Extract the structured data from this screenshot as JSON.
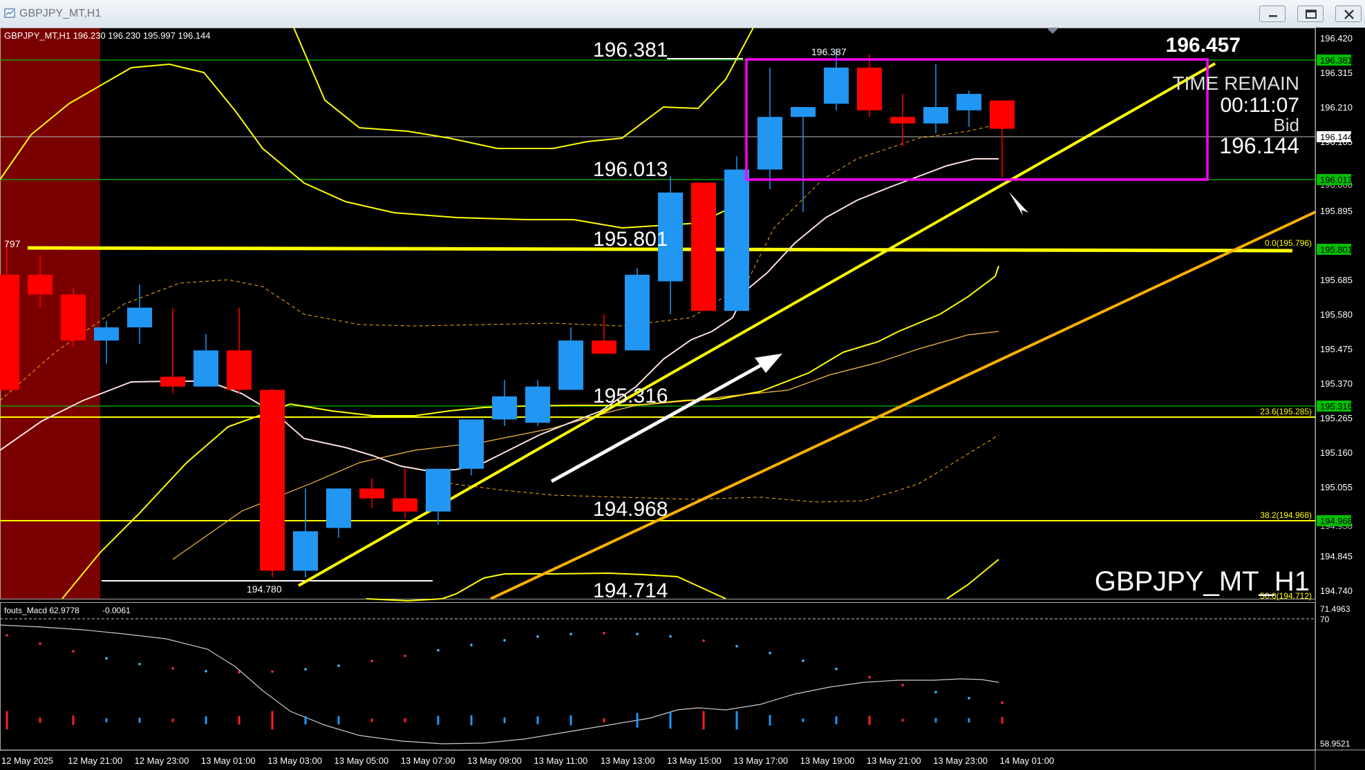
{
  "window": {
    "title": "GBPJPY_MT,H1",
    "icon": "chart-window-icon",
    "buttons": [
      "minimize-icon",
      "restore-icon",
      "close-icon"
    ]
  },
  "chart": {
    "info_line": "GBPJPY_MT,H1  196.230 196.230 195.997 196.144",
    "symbol_watermark": "GBPJPY_MT_H1",
    "colors": {
      "background": "#000000",
      "bull": "#2196f3",
      "bear": "#ff0000",
      "level": "#ffff00",
      "box": "#ff00ff",
      "price_tag_green": "#00c000"
    },
    "high_price_top": "196.457",
    "time_remain_label": "TIME REMAIN",
    "time_remain_value": "00:11:07",
    "bid_label": "Bid",
    "bid_value": "196.144",
    "level_labels": [
      "196.381",
      "196.013",
      "195.801",
      "195.316",
      "194.968",
      "194.714"
    ],
    "candle_high_label": "196.387",
    "candle_low_label": "194.780",
    "left_cut_label": "797",
    "fib_labels": [
      "0.0(195.796)",
      "23.6(195.285)",
      "38.2(194.968)",
      "50.0(194.712)"
    ],
    "price_axis": [
      "196.420",
      "196.315",
      "196.210",
      "196.105",
      "195.895",
      "195.685",
      "195.580",
      "195.475",
      "195.370",
      "195.265",
      "195.160",
      "195.055",
      "194.845",
      "194.740"
    ],
    "price_tags": {
      "green": [
        "196.381",
        "195.801",
        "195.316",
        "194.968"
      ],
      "bid": "196.144",
      "level": "196.013",
      "partial": "196.000",
      "partial2": "194.950"
    },
    "time_axis": [
      "12 May 2025",
      "12 May 21:00",
      "12 May 23:00",
      "13 May 01:00",
      "13 May 03:00",
      "13 May 05:00",
      "13 May 07:00",
      "13 May 09:00",
      "13 May 11:00",
      "13 May 13:00",
      "13 May 15:00",
      "13 May 17:00",
      "13 May 19:00",
      "13 May 21:00",
      "13 May 23:00",
      "14 May 01:00"
    ],
    "candles": [
      {
        "o": 195.7,
        "h": 195.8,
        "l": 195.35,
        "c": 195.35
      },
      {
        "o": 195.7,
        "h": 195.76,
        "l": 195.6,
        "c": 195.64
      },
      {
        "o": 195.64,
        "h": 195.66,
        "l": 195.48,
        "c": 195.5
      },
      {
        "o": 195.5,
        "h": 195.56,
        "l": 195.43,
        "c": 195.54
      },
      {
        "o": 195.54,
        "h": 195.67,
        "l": 195.49,
        "c": 195.6
      },
      {
        "o": 195.39,
        "h": 195.6,
        "l": 195.34,
        "c": 195.36
      },
      {
        "o": 195.36,
        "h": 195.52,
        "l": 195.36,
        "c": 195.47
      },
      {
        "o": 195.47,
        "h": 195.6,
        "l": 195.34,
        "c": 195.35
      },
      {
        "o": 195.35,
        "h": 195.35,
        "l": 194.78,
        "c": 194.8
      },
      {
        "o": 194.8,
        "h": 195.05,
        "l": 194.78,
        "c": 194.92
      },
      {
        "o": 194.93,
        "h": 195.05,
        "l": 194.9,
        "c": 195.05
      },
      {
        "o": 195.05,
        "h": 195.08,
        "l": 194.99,
        "c": 195.02
      },
      {
        "o": 195.02,
        "h": 195.11,
        "l": 194.96,
        "c": 194.98
      },
      {
        "o": 194.98,
        "h": 195.11,
        "l": 194.94,
        "c": 195.11
      },
      {
        "o": 195.11,
        "h": 195.25,
        "l": 195.09,
        "c": 195.26
      },
      {
        "o": 195.26,
        "h": 195.38,
        "l": 195.24,
        "c": 195.33
      },
      {
        "o": 195.25,
        "h": 195.38,
        "l": 195.24,
        "c": 195.36
      },
      {
        "o": 195.35,
        "h": 195.54,
        "l": 195.35,
        "c": 195.5
      },
      {
        "o": 195.5,
        "h": 195.58,
        "l": 195.46,
        "c": 195.46
      },
      {
        "o": 195.47,
        "h": 195.72,
        "l": 195.47,
        "c": 195.7
      },
      {
        "o": 195.68,
        "h": 196.0,
        "l": 195.58,
        "c": 195.95
      },
      {
        "o": 195.98,
        "h": 195.98,
        "l": 195.62,
        "c": 195.59
      },
      {
        "o": 195.59,
        "h": 196.06,
        "l": 195.59,
        "c": 196.02
      },
      {
        "o": 196.02,
        "h": 196.33,
        "l": 195.96,
        "c": 196.18
      },
      {
        "o": 196.18,
        "h": 196.21,
        "l": 195.89,
        "c": 196.21
      },
      {
        "o": 196.22,
        "h": 196.387,
        "l": 196.2,
        "c": 196.33
      },
      {
        "o": 196.33,
        "h": 196.37,
        "l": 196.18,
        "c": 196.2
      },
      {
        "o": 196.18,
        "h": 196.25,
        "l": 196.09,
        "c": 196.16
      },
      {
        "o": 196.16,
        "h": 196.34,
        "l": 196.13,
        "c": 196.21
      },
      {
        "o": 196.2,
        "h": 196.26,
        "l": 196.15,
        "c": 196.25
      },
      {
        "o": 196.23,
        "h": 196.23,
        "l": 195.997,
        "c": 196.144
      }
    ],
    "indicator": {
      "label": "fouts_Macd 62.9778",
      "label2": "-0.0061",
      "axis_top": "71.4963",
      "axis_mid": "70",
      "axis_bottom": "58.9521"
    }
  }
}
